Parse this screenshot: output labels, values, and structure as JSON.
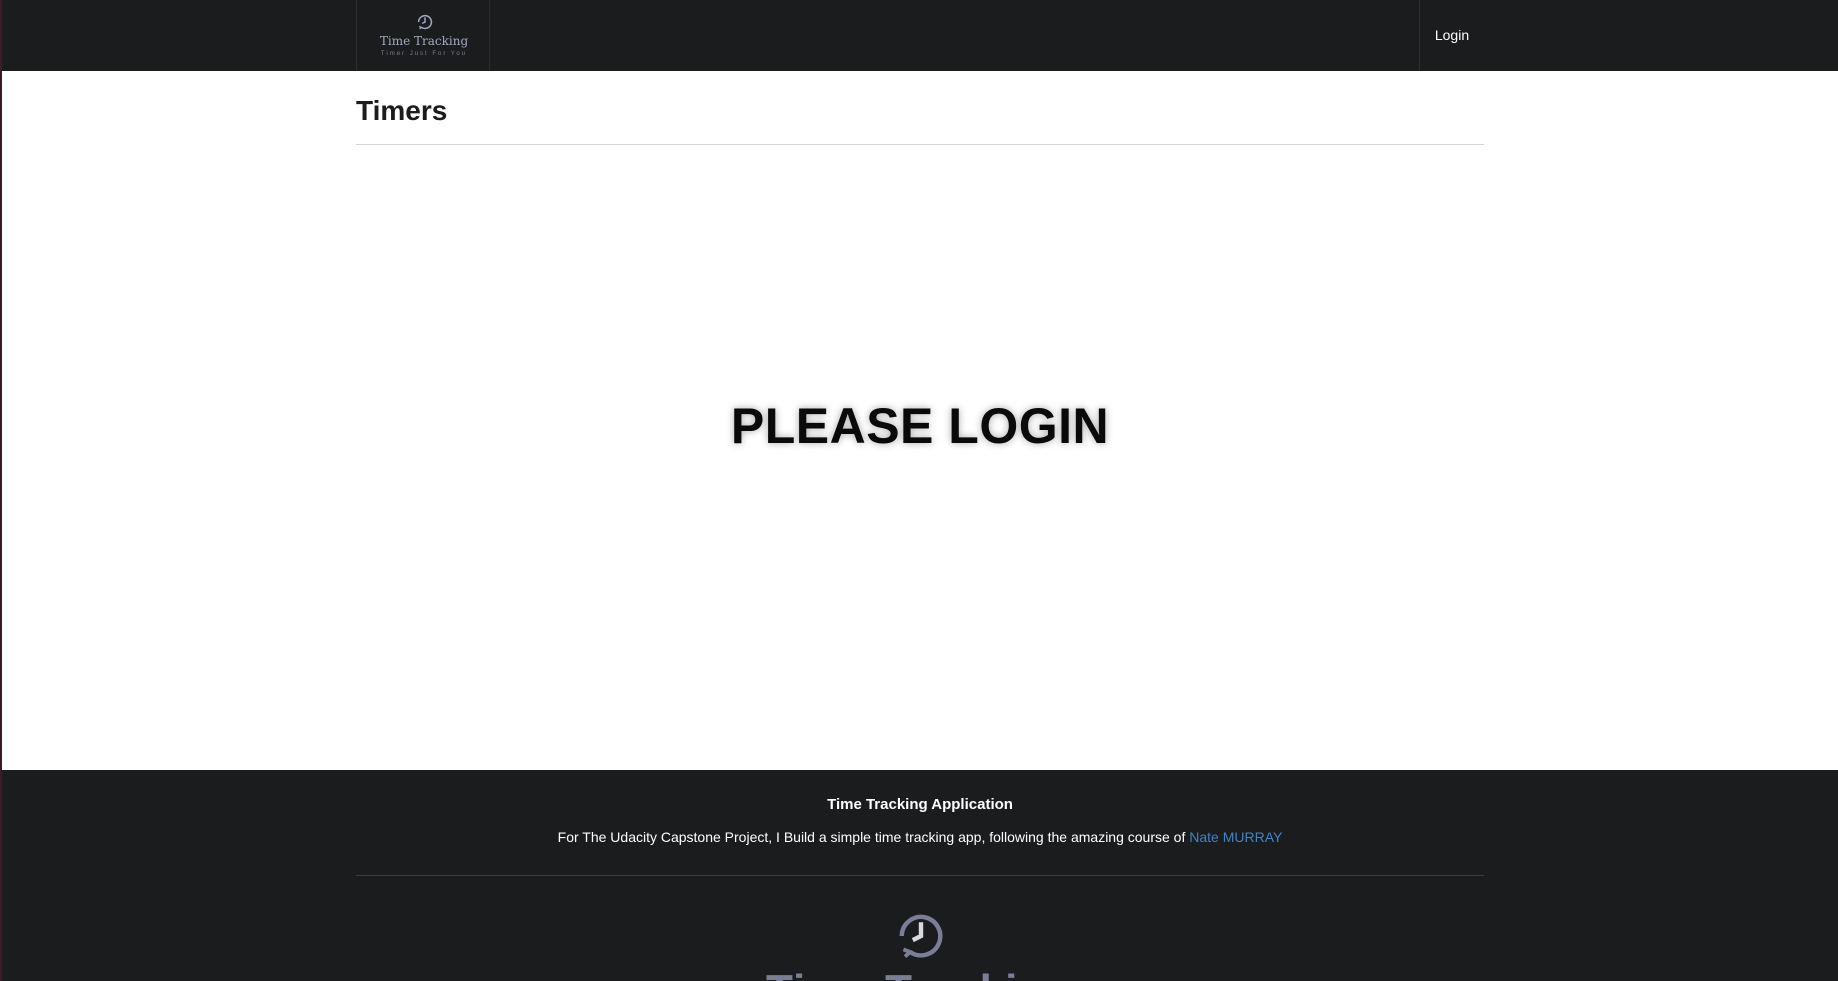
{
  "header": {
    "brand_title": "Time Tracking",
    "brand_tagline": "Timer Just For You",
    "brand_icon": "clock-history-icon",
    "login_label": "Login"
  },
  "main": {
    "page_title": "Timers",
    "message": "PLEASE LOGIN"
  },
  "footer": {
    "heading": "Time Tracking Application",
    "text": "For The Udacity Capstone Project, I Build a simple time tracking app, following the amazing course of ",
    "link_label": "Nate MURRAY",
    "logo_icon": "clock-history-icon",
    "logo_text": "Time Tracking"
  },
  "colors": {
    "dark_bg": "#1b1c1d",
    "link": "#4183c4",
    "brand_accent": "#a4a8c0"
  }
}
